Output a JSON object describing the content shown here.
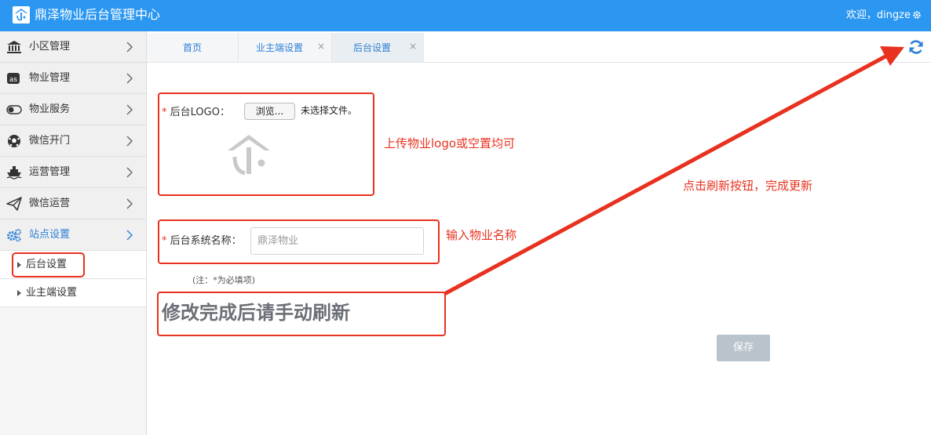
{
  "header": {
    "title": "鼎泽物业后台管理中心",
    "welcome": "欢迎，dingze",
    "brand_color": "#2b97f1"
  },
  "sidebar": {
    "items": [
      {
        "label": "小区管理",
        "icon": "bank-icon"
      },
      {
        "label": "物业管理",
        "icon": "lastfm-icon"
      },
      {
        "label": "物业服务",
        "icon": "toggle-icon"
      },
      {
        "label": "微信开门",
        "icon": "soccer-ball-icon"
      },
      {
        "label": "运营管理",
        "icon": "ship-icon"
      },
      {
        "label": "微信运营",
        "icon": "paper-plane-icon"
      },
      {
        "label": "站点设置",
        "icon": "gears-icon",
        "active": true
      }
    ],
    "sub_items": [
      {
        "label": "后台设置"
      },
      {
        "label": "业主端设置"
      }
    ]
  },
  "tabs": [
    {
      "label": "首页"
    },
    {
      "label": "业主端设置",
      "close": "×"
    },
    {
      "label": "后台设置",
      "close": "×",
      "active": true
    }
  ],
  "form": {
    "logo_label": "后台LOGO：",
    "browse_label": "浏览...",
    "file_status": "未选择文件。",
    "name_label": "后台系统名称：",
    "name_placeholder": "鼎泽物业",
    "required_mark": "*",
    "note": "(注：*为必填项)",
    "save_label": "保存"
  },
  "annotations": {
    "logo_hint": "上传物业logo或空置均可",
    "name_hint": "输入物业名称",
    "refresh_hint": "点击刷新按钮，完成更新",
    "manual_refresh": "修改完成后请手动刷新",
    "color": "#e8311f"
  }
}
